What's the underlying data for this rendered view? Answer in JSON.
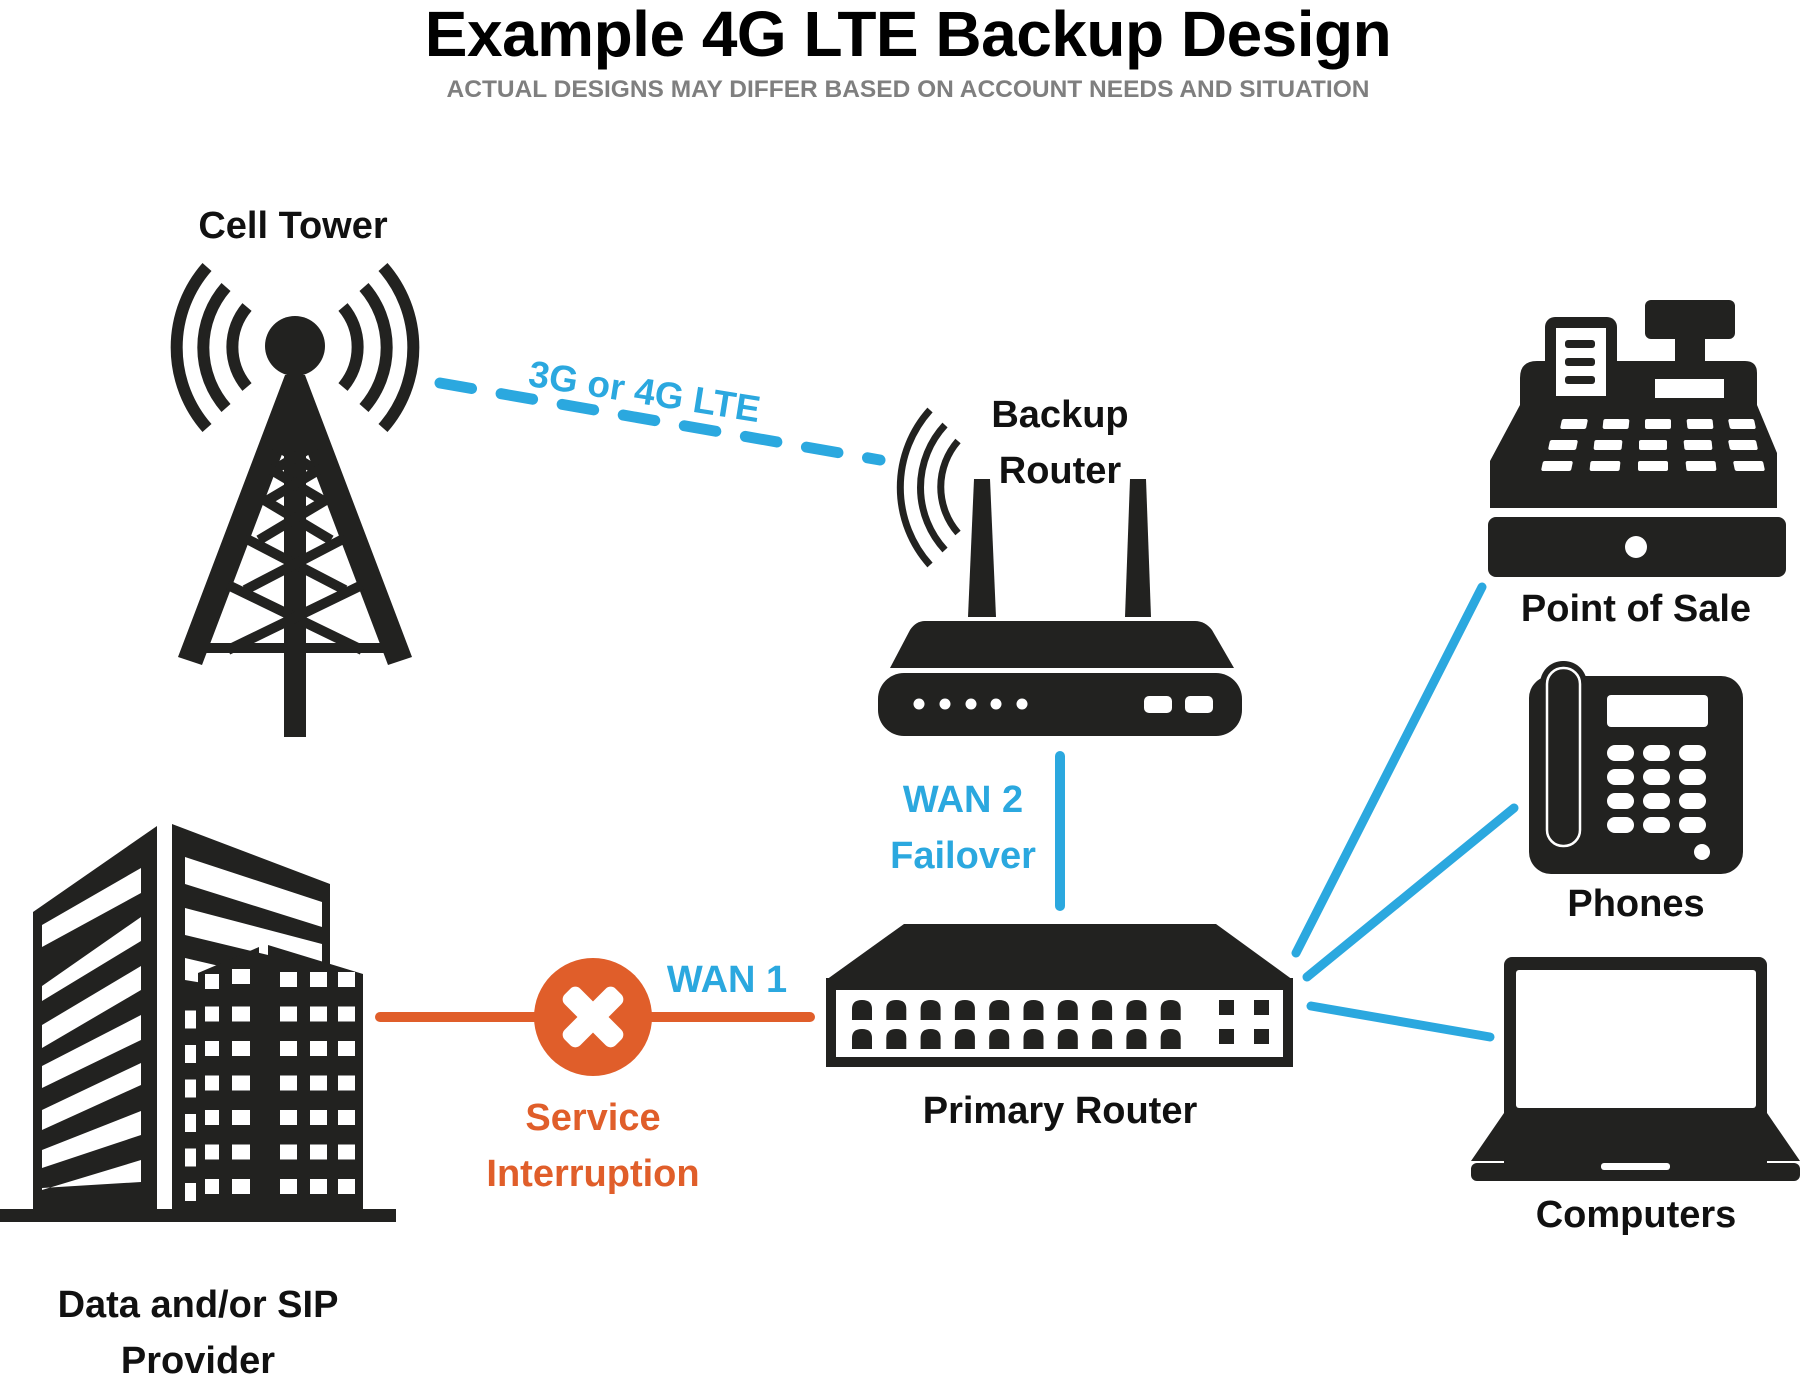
{
  "header": {
    "title": "Example 4G LTE Backup Design",
    "subtitle": "ACTUAL DESIGNS MAY DIFFER BASED ON ACCOUNT NEEDS AND SITUATION"
  },
  "colors": {
    "icon": "#222220",
    "active_link": "#2BA8DF",
    "failed_link": "#E05E2A",
    "subtitle": "#7f7f7f"
  },
  "nodes": {
    "cell_tower": {
      "label": "Cell Tower",
      "icon": "cell-tower-icon"
    },
    "backup_router": {
      "label_line1": "Backup",
      "label_line2": "Router",
      "icon": "wireless-router-icon"
    },
    "primary_router": {
      "label": "Primary Router",
      "icon": "network-switch-icon"
    },
    "provider": {
      "label_line1": "Data and/or SIP",
      "label_line2": "Provider",
      "icon": "office-building-icon"
    },
    "point_of_sale": {
      "label": "Point of Sale",
      "icon": "cash-register-icon"
    },
    "phones": {
      "label": "Phones",
      "icon": "desk-phone-icon"
    },
    "computers": {
      "label": "Computers",
      "icon": "laptop-icon"
    }
  },
  "links": {
    "cellular": {
      "label": "3G or 4G LTE",
      "style": "dashed",
      "status": "active"
    },
    "wan2": {
      "label_line1": "WAN 2",
      "label_line2": "Failover",
      "status": "active"
    },
    "wan1": {
      "label": "WAN 1",
      "status": "interrupted"
    },
    "interruption": {
      "label_line1": "Service",
      "label_line2": "Interruption",
      "icon": "error-x-icon"
    }
  },
  "primary_router_ports": {
    "rows": 2,
    "ethernet_per_row": 10,
    "square_per_row": 2
  },
  "backup_router_leds": {
    "dots": 5,
    "buttons": 2
  }
}
